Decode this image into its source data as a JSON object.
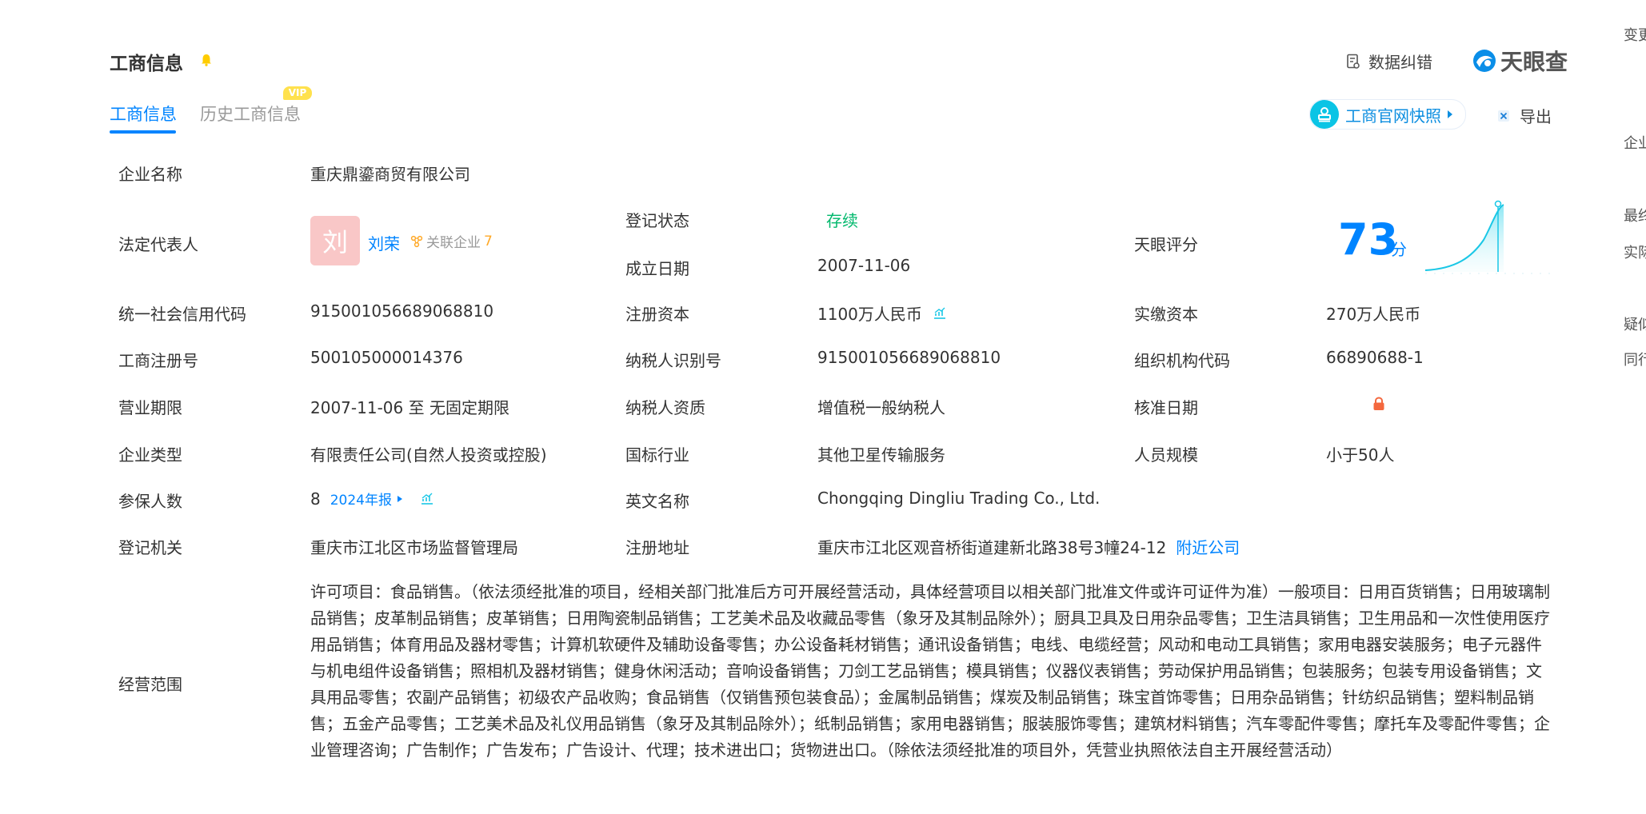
{
  "section": {
    "title": "工商信息"
  },
  "tabs": {
    "active": "工商信息",
    "history": "历史工商信息",
    "vip_badge": "VIP"
  },
  "top_actions": {
    "data_correct": "数据纠错",
    "brand": "天眼查",
    "snapshot": "工商官网快照",
    "export": "导出"
  },
  "info": {
    "company_name_label": "企业名称",
    "company_name": "重庆鼎鎏商贸有限公司",
    "legal_rep_label": "法定代表人",
    "legal_rep_avatar": "刘",
    "legal_rep": "刘荣",
    "related_label": "关联企业",
    "related_count": "7",
    "reg_status_label": "登记状态",
    "reg_status": "存续",
    "found_date_label": "成立日期",
    "found_date": "2007-11-06",
    "tianyan_score_label": "天眼评分",
    "tianyan_score": "73",
    "score_unit": "分",
    "credit_code_label": "统一社会信用代码",
    "credit_code": "915001056689068810",
    "reg_capital_label": "注册资本",
    "reg_capital": "1100万人民币",
    "paid_capital_label": "实缴资本",
    "paid_capital": "270万人民币",
    "biz_reg_no_label": "工商注册号",
    "biz_reg_no": "500105000014376",
    "taxpayer_id_label": "纳税人识别号",
    "taxpayer_id": "915001056689068810",
    "org_code_label": "组织机构代码",
    "org_code": "66890688-1",
    "biz_term_label": "营业期限",
    "biz_term": "2007-11-06 至 无固定期限",
    "taxpayer_qual_label": "纳税人资质",
    "taxpayer_qual": "增值税一般纳税人",
    "approve_date_label": "核准日期",
    "company_type_label": "企业类型",
    "company_type": "有限责任公司(自然人投资或控股)",
    "industry_label": "国标行业",
    "industry": "其他卫星传输服务",
    "staff_size_label": "人员规模",
    "staff_size": "小于50人",
    "insured_label": "参保人数",
    "insured": "8",
    "annual_report": "2024年报",
    "english_name_label": "英文名称",
    "english_name": "Chongqing Dingliu Trading Co., Ltd.",
    "reg_authority_label": "登记机关",
    "reg_authority": "重庆市江北区市场监督管理局",
    "reg_address_label": "注册地址",
    "reg_address": "重庆市江北区观音桥街道建新北路38号3幢24-12",
    "nearby": "附近公司",
    "scope_label": "经营范围",
    "scope": "许可项目：食品销售。（依法须经批准的项目，经相关部门批准后方可开展经营活动，具体经营项目以相关部门批准文件或许可证件为准）一般项目：日用百货销售；日用玻璃制品销售；皮革制品销售；皮革销售；日用陶瓷制品销售；工艺美术品及收藏品零售（象牙及其制品除外）；厨具卫具及日用杂品零售；卫生洁具销售；卫生用品和一次性使用医疗用品销售；体育用品及器材零售；计算机软硬件及辅助设备零售；办公设备耗材销售；通讯设备销售；电线、电缆经营；风动和电动工具销售；家用电器安装服务；电子元器件与机电组件设备销售；照相机及器材销售；健身休闲活动；音响设备销售；刀剑工艺品销售；模具销售；仪器仪表销售；劳动保护用品销售；包装服务；包装专用设备销售；文具用品零售；农副产品销售；初级农产品收购；食品销售（仅销售预包装食品）；金属制品销售；煤炭及制品销售；珠宝首饰零售；日用杂品销售；针纺织品销售；塑料制品销售；五金产品零售；工艺美术品及礼仪用品销售（象牙及其制品除外）；纸制品销售；家用电器销售；服装服饰零售；建筑材料销售；汽车零配件零售；摩托车及零配件零售；企业管理咨询；广告制作；广告发布；广告设计、代理；技术进出口；货物进出口。（除依法须经批准的项目外，凭营业执照依法自主开展经营活动）"
  },
  "sidebar": {
    "items": [
      "变更",
      "企业",
      "最终",
      "实际",
      "疑似",
      "同行"
    ]
  },
  "colors": {
    "accent": "#0084ff",
    "status": "#00b86c",
    "vip": "#ffe14d",
    "related": "#ffa928"
  }
}
